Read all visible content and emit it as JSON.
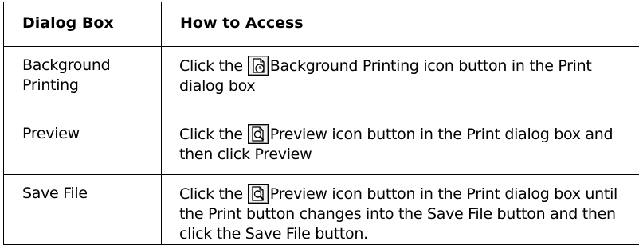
{
  "table": {
    "headers": [
      "Dialog Box",
      "How to Access"
    ],
    "rows": [
      {
        "dialog": [
          "Background",
          "Printing"
        ],
        "pre": "Click the",
        "icon": "background-printing-icon",
        "post": "Background Printing icon button in the Print dialog box"
      },
      {
        "dialog": [
          "Preview"
        ],
        "pre": "Click the",
        "icon": "preview-icon",
        "post": "Preview icon button in the Print dialog box and then click Preview"
      },
      {
        "dialog": [
          "Save File"
        ],
        "pre": "Click the",
        "icon": "preview-icon",
        "post": "Preview icon button in the Print dialog box until the Print button changes into the Save File button and then click the Save File button."
      }
    ]
  }
}
